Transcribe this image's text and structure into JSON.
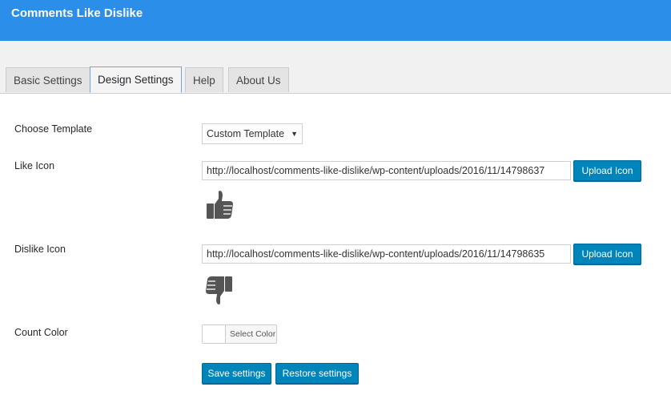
{
  "header": {
    "title": "Comments Like Dislike"
  },
  "tabs": [
    {
      "label": "Basic Settings",
      "active": false
    },
    {
      "label": "Design Settings",
      "active": true
    },
    {
      "label": "Help",
      "active": false
    },
    {
      "label": "About Us",
      "active": false
    }
  ],
  "form": {
    "template": {
      "label": "Choose Template",
      "selected": "Custom Template"
    },
    "like_icon": {
      "label": "Like Icon",
      "url": "http://localhost/comments-like-dislike/wp-content/uploads/2016/11/14798637",
      "upload_label": "Upload Icon",
      "icon": "thumbs-up-icon"
    },
    "dislike_icon": {
      "label": "Dislike Icon",
      "url": "http://localhost/comments-like-dislike/wp-content/uploads/2016/11/14798635",
      "upload_label": "Upload Icon",
      "icon": "thumbs-down-icon"
    },
    "count_color": {
      "label": "Count Color",
      "picker_label": "Select Color",
      "value": "#ffffff"
    }
  },
  "actions": {
    "save_label": "Save settings",
    "restore_label": "Restore settings"
  },
  "colors": {
    "header_bg": "#2b8ee8",
    "primary_button": "#0085ba",
    "icon_fill": "#555555"
  }
}
